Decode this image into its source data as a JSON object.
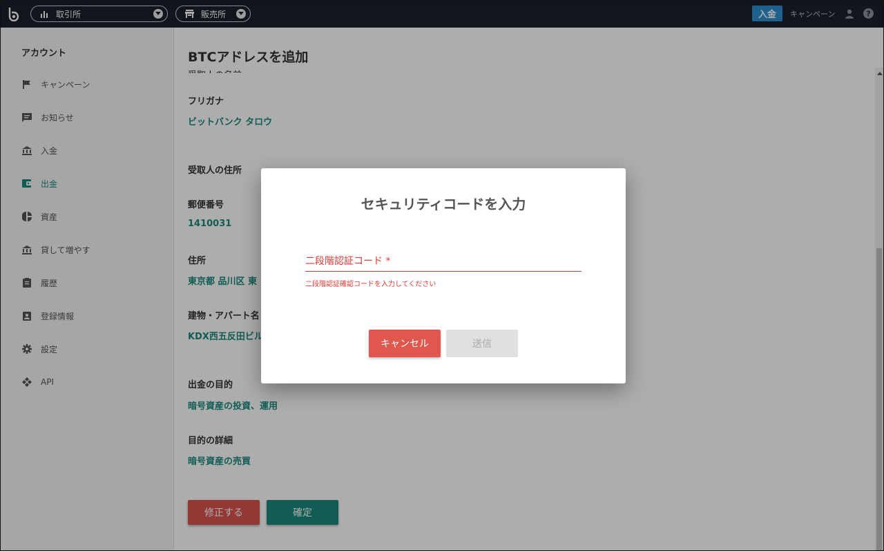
{
  "topbar": {
    "exchange_label": "取引所",
    "shop_label": "販売所",
    "deposit_label": "入金",
    "campaign_label": "キャンペーン"
  },
  "sidebar": {
    "heading": "アカウント",
    "items": [
      {
        "label": "キャンペーン",
        "icon": "flag-icon"
      },
      {
        "label": "お知らせ",
        "icon": "message-icon"
      },
      {
        "label": "入金",
        "icon": "bank-icon"
      },
      {
        "label": "出金",
        "icon": "wallet-icon"
      },
      {
        "label": "資産",
        "icon": "pie-chart-icon"
      },
      {
        "label": "貸して増やす",
        "icon": "bank-icon"
      },
      {
        "label": "履歴",
        "icon": "clipboard-icon"
      },
      {
        "label": "登録情報",
        "icon": "id-badge-icon"
      },
      {
        "label": "設定",
        "icon": "gear-icon"
      },
      {
        "label": "API",
        "icon": "api-icon"
      }
    ]
  },
  "main": {
    "title": "BTCアドレスを追加",
    "cut_text": "受取人の名前",
    "fields": [
      {
        "label": "フリガナ",
        "value": "ビットバンク タロウ"
      },
      {
        "label": "受取人の住所",
        "value": ""
      },
      {
        "label": "郵便番号",
        "value": "1410031"
      },
      {
        "label": "住所",
        "value": "東京都 品川区 東"
      },
      {
        "label": "建物・アパート名",
        "value": "KDX西五反田ビル"
      },
      {
        "label": "出金の目的",
        "value": "暗号資産の投資、運用"
      },
      {
        "label": "目的の詳細",
        "value": "暗号資産の売買"
      }
    ],
    "edit_label": "修正する",
    "confirm_label": "確定"
  },
  "dialog": {
    "title": "セキュリティコードを入力",
    "field_label": "二段階認証コード *",
    "field_value": "",
    "error_text": "二段階認証確認コードを入力してください",
    "cancel_label": "キャンセル",
    "send_label": "送信"
  },
  "colors": {
    "accent": "#1a8a7c",
    "danger": "#e0584d",
    "topbar": "#1b1f2a",
    "deposit": "#2f8fd0"
  }
}
